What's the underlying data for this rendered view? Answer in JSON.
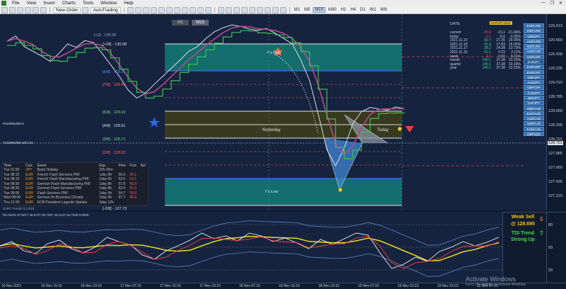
{
  "menu": {
    "items": [
      "File",
      "View",
      "Insert",
      "Charts",
      "Tools",
      "Window",
      "Help"
    ]
  },
  "toolbar": {
    "new_order": "New Order",
    "auto_trading": "AutoTrading",
    "timeframes": [
      "M1",
      "M5",
      "M15",
      "M30",
      "H1",
      "H4",
      "D1",
      "W1",
      "MN"
    ],
    "active_timeframe": "M15"
  },
  "chart": {
    "tf_boxes": [
      "H1",
      "M15"
    ],
    "selected_tf_box": "M15",
    "levels": [
      {
        "text": "[+28] - 130.08"
      },
      {
        "text": "[7/8] - 129.45"
      },
      {
        "text": "[6/8] - 129.35"
      },
      {
        "text": "[5/8] - 129.10"
      },
      {
        "text": "[4/8] - 128.91"
      },
      {
        "text": "[3/8] - 128.71"
      },
      {
        "text": "[2/8] - 128.52"
      },
      {
        "text": "[-2/8] - 127.73"
      }
    ],
    "session_labels": {
      "yesterday": "Yesterday",
      "today": "Today",
      "ys_high": "Y's High",
      "ys_low": "Y's Low"
    },
    "left_labels": [
      "#120084298 sl",
      "#120084298 sell 0.01"
    ],
    "top_header": "[+2] - 130.08",
    "footer_note": "GoPC Trends (c) 2021"
  },
  "news": {
    "headers": [
      "Time",
      "Curr.",
      "Event",
      "Exp.",
      "Prev",
      "Fcst",
      "Act"
    ],
    "rows": [
      [
        "Tue 01:00",
        "JPY",
        "Bank Holiday",
        "22h 05m",
        "",
        "",
        ""
      ],
      [
        "Tue 08:15",
        "EUR",
        "French Flash Services PMI",
        "1day 8h",
        "56.6",
        "56.1",
        ""
      ],
      [
        "Tue 08:15",
        "EUR",
        "French Flash Manufacturing PMI",
        "1day 8h",
        "53.6",
        "53.1",
        ""
      ],
      [
        "Tue 08:30",
        "EUR",
        "German Flash Manufacturing PMI",
        "1day 8h",
        "57.8",
        "56.9",
        ""
      ],
      [
        "Tue 08:30",
        "EUR",
        "German Flash Services PMI",
        "1day 8h",
        "52.4",
        "51.6",
        ""
      ],
      [
        "Tue 09:00",
        "EUR",
        "Flash Services PMI",
        "1day 9h",
        "54.7",
        "53.6",
        ""
      ],
      [
        "Wed 09:00",
        "EUR",
        "German Ifo Business Climate",
        "2day 9h",
        "97.7",
        "96.6",
        ""
      ],
      [
        "Thu 12:30",
        "EUR",
        "ECB President Lagarde Speaks",
        "3day 12h",
        "",
        "",
        ""
      ]
    ]
  },
  "stats": {
    "header": "DATE",
    "rows": [
      {
        "label": "current",
        "v": "-25.6",
        "p": "-15.1",
        "c": "-21.66%",
        "color": "#ff4d4d"
      },
      {
        "label": "today",
        "v": "-2.1",
        "p": "-0.6",
        "c": "-0.30%",
        "color": "#ff4d4d"
      },
      {
        "label": "2021.11.19",
        "v": "56.7",
        "p": "27.35",
        "c": "20.06%",
        "color": "#3ddc84"
      },
      {
        "label": "2021.11.18",
        "v": "41.9",
        "p": "17.83",
        "c": "15.03%",
        "color": "#3ddc84"
      },
      {
        "label": "2021.11.17",
        "v": "38.2",
        "p": "14.38",
        "c": "13.73%",
        "color": "#3ddc84"
      },
      {
        "label": "2021.11.16",
        "v": "51.1",
        "p": "4.22",
        "c": "2.11%",
        "color": "#3ddc84"
      },
      {
        "label": "week",
        "v": "-2.1",
        "p": "0.00",
        "c": "0.31%",
        "color": "#ff4d4d"
      },
      {
        "label": "month",
        "v": "140.1",
        "p": "37.38",
        "c": "10.15%",
        "color": "#3ddc84"
      },
      {
        "label": "quarter",
        "v": "140.1",
        "p": "37.38",
        "c": "10.15%",
        "color": "#3ddc84"
      },
      {
        "label": "year",
        "v": "140.1",
        "p": "37.38",
        "c": "10.15%",
        "color": "#3ddc84"
      }
    ],
    "banner": "EURJPY,M15"
  },
  "pairs": [
    "EURUSD",
    "GBPUSD",
    "USDJPY",
    "AUDUSD",
    "NZDUSD",
    "USDCAD",
    "USDCHF",
    "EURJPY",
    "EURGBP",
    "EURCHF",
    "GBPJPY",
    "AUDJPY",
    "GBPCHF",
    "CADJPY",
    "NZDJPY",
    "CHFJPY",
    "GBPCAD",
    "EURAUD",
    "AUDCAD",
    "GBPAUD",
    "EURCAD",
    "GBPNZD"
  ],
  "selected_pair": "EURJPY",
  "price_axis": [
    "129.913",
    "129.660",
    "129.438",
    "129.235",
    "129.010",
    "128.785",
    "128.560",
    "128.335",
    "128.110",
    "127.885",
    "127.660",
    "127.435",
    "127.210"
  ],
  "price_marker": "128.701",
  "osc_axis": [
    "80",
    "50",
    "20"
  ],
  "signal": {
    "weak_sell": "Weak Sell",
    "price": "@ 128.695",
    "trend": "TDI Trend",
    "strength": "Strong Up"
  },
  "osc_label": "TDI Alerts 37.5077 46.8737 36.7397 49.2147 54.7029 0.0000",
  "time_axis": [
    "16 Nov 2021",
    "16 Nov 15:15",
    "16 Nov 23:15",
    "17 Nov 07:15",
    "17 Nov 15:15",
    "17 Nov 23:15",
    "18 Nov 07:15",
    "18 Nov 15:15",
    "18 Nov 23:15",
    "19 Nov 07:15",
    "19 Nov 15:15",
    "19 Nov 23:15",
    "22 Nov 07:15"
  ],
  "watermark": {
    "title": "Activate Windows",
    "sub": "Go to PC settings to activate Windows."
  },
  "chart_data": {
    "type": "line",
    "symbol": "EURJPY",
    "timeframe": "M15",
    "price_range": [
      127.2,
      130.1
    ],
    "close_series": [
      129.7,
      129.78,
      129.62,
      129.55,
      129.48,
      129.4,
      129.52,
      129.66,
      129.61,
      129.71,
      129.68,
      129.52,
      129.35,
      129.18,
      128.98,
      128.86,
      128.93,
      129.06,
      129.18,
      129.3,
      129.42,
      129.55,
      129.62,
      129.74,
      129.84,
      129.9,
      129.94,
      129.92,
      129.88,
      129.86,
      129.89,
      129.82,
      129.74,
      129.66,
      129.42,
      129.12,
      128.62,
      128.1,
      127.86,
      128.12,
      128.48,
      128.66,
      128.72,
      128.7,
      128.68,
      128.73,
      128.7
    ],
    "osc_range": [
      0,
      100
    ],
    "osc_series": [
      52,
      58,
      45,
      41,
      55,
      60,
      48,
      42,
      50,
      64,
      58,
      53,
      39,
      33,
      45,
      52,
      60,
      70,
      62,
      66,
      59,
      70,
      66,
      58,
      63,
      56,
      48,
      61,
      54,
      62,
      70,
      67,
      42,
      20,
      26,
      36,
      30,
      44,
      50,
      58,
      52,
      57,
      64
    ]
  }
}
